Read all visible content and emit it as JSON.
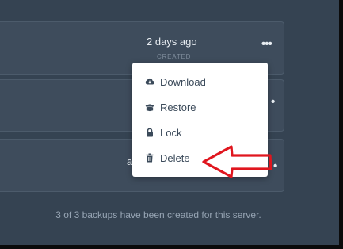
{
  "backups": [
    {
      "created_time": "2 days ago",
      "created_label": "CREATED",
      "menu_icon": "more-horizontal-icon"
    },
    {
      "menu_icon": "more-horizontal-icon"
    },
    {
      "text_fragment": "a",
      "menu_icon": "more-horizontal-icon"
    }
  ],
  "context_menu": {
    "items": [
      {
        "label": "Download",
        "icon": "cloud-download-icon"
      },
      {
        "label": "Restore",
        "icon": "box-open-icon"
      },
      {
        "label": "Lock",
        "icon": "lock-icon"
      },
      {
        "label": "Delete",
        "icon": "trash-icon"
      }
    ]
  },
  "footer": {
    "summary": "3 of 3 backups have been created for this server."
  },
  "annotation": {
    "type": "arrow",
    "color": "#e0161e",
    "icon": "arrow-left-icon"
  },
  "colors": {
    "background": "#354352",
    "row_background": "#3e4c5c",
    "menu_text": "#3b4a5a",
    "muted_text": "#97a5b4"
  }
}
